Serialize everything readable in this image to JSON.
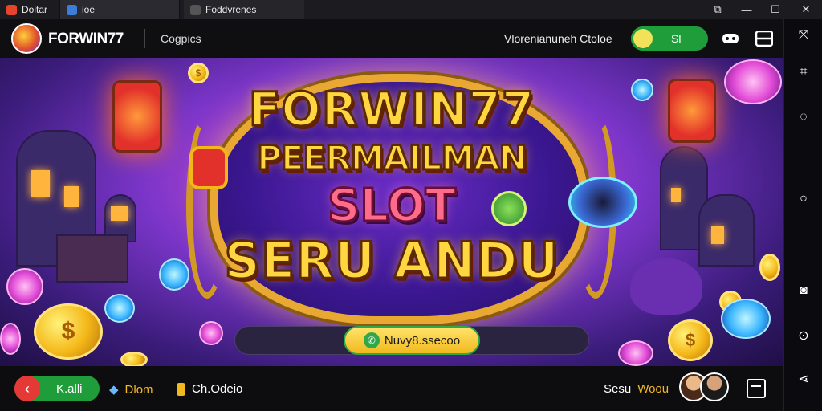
{
  "window": {
    "tabs": [
      {
        "label": "Doitar",
        "icon_color": "#e7452b"
      },
      {
        "label": "ioe",
        "icon_color": "#3b7dd8"
      },
      {
        "label": "Foddvrenes",
        "icon_color": "#555555"
      }
    ],
    "controls": {
      "restore": "⧉",
      "minimize": "—",
      "maximize": "☐",
      "close": "✕"
    }
  },
  "header": {
    "brand": "FORWIN77",
    "nav_left": "Cogpics",
    "nav_right": "Vlorenianuneh Ctoloe",
    "toggle_label": "Sl",
    "icons": [
      "gamepad-icon",
      "menu-icon"
    ]
  },
  "hero": {
    "line1": "FORWIN77",
    "line2": "PEERMAILMAN",
    "line3": "SLOT",
    "line4": "SERU ANDU",
    "cta_label": "Nuvy8.ssecoo"
  },
  "bottom": {
    "back_label": "K.alli",
    "item1": "Dlom",
    "item2": "Ch.Odeio",
    "right_label_white": "Sesu",
    "right_label_gold": "Woou"
  },
  "colors": {
    "accent_green": "#1f9d3a",
    "gold": "#ffd640",
    "back_red": "#e53935",
    "hero_purple": "#7a35c8"
  }
}
